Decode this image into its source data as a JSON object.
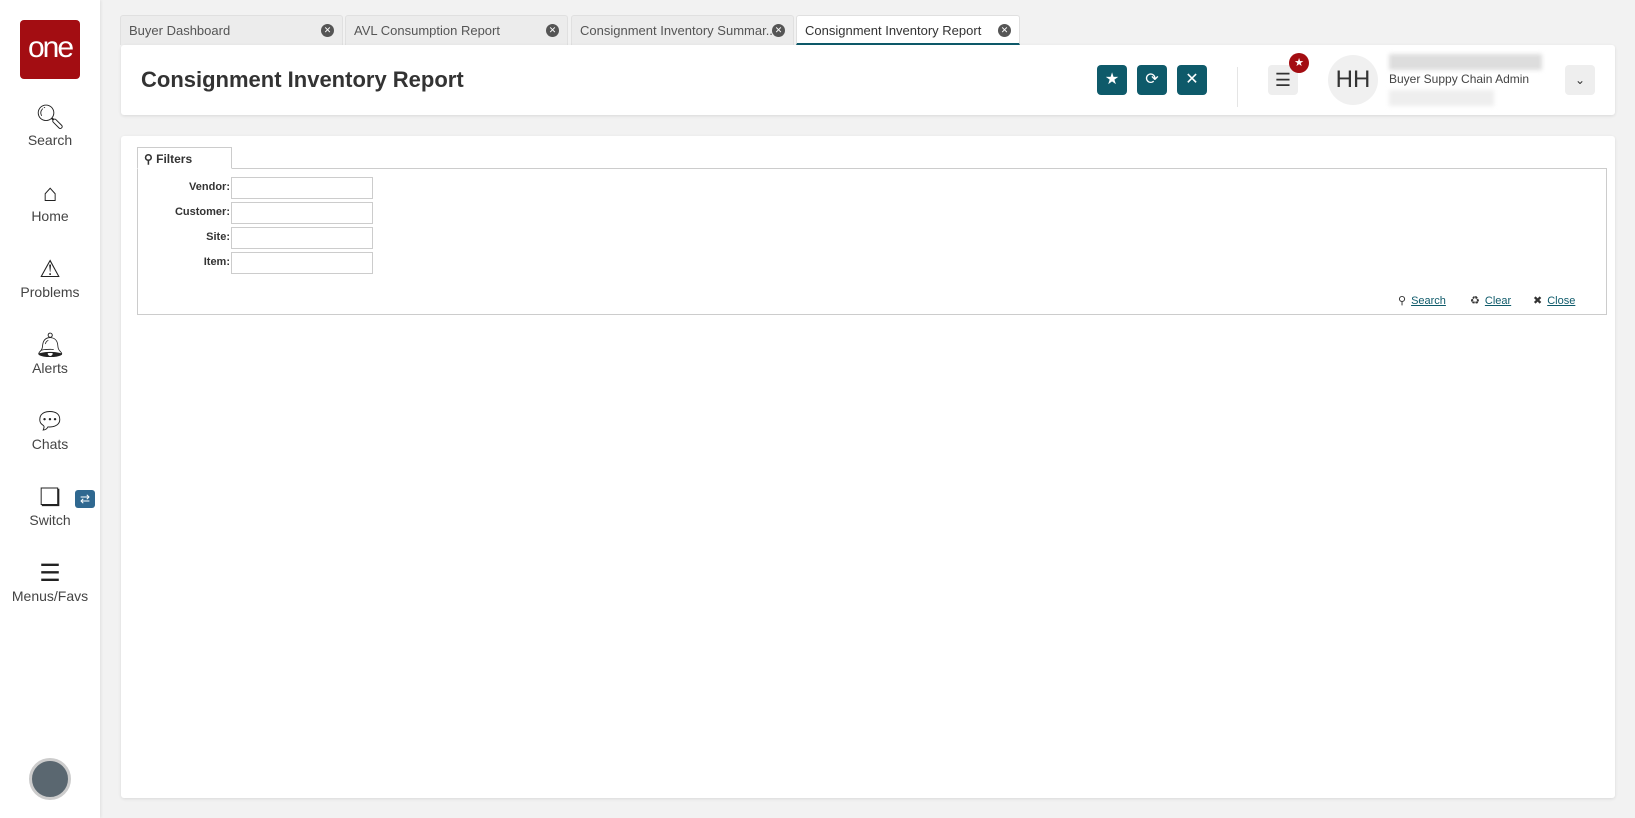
{
  "sidebar": {
    "logo": "one",
    "items": [
      {
        "label": "Search",
        "icon": "search-icon"
      },
      {
        "label": "Home",
        "icon": "home-icon"
      },
      {
        "label": "Problems",
        "icon": "warning-icon"
      },
      {
        "label": "Alerts",
        "icon": "bell-icon"
      },
      {
        "label": "Chats",
        "icon": "chat-icon"
      },
      {
        "label": "Switch",
        "icon": "switch-icon"
      },
      {
        "label": "Menus/Favs",
        "icon": "menu-icon"
      }
    ]
  },
  "tabs": [
    {
      "label": "Buyer Dashboard"
    },
    {
      "label": "AVL Consumption Report"
    },
    {
      "label": "Consignment Inventory Summar..."
    },
    {
      "label": "Consignment Inventory Report",
      "active": true
    }
  ],
  "header": {
    "title": "Consignment Inventory Report",
    "user_initials": "HH",
    "user_role": "Buyer Suppy Chain Admin"
  },
  "filters": {
    "tab_label": "Filters",
    "fields": [
      {
        "label": "Vendor:",
        "value": ""
      },
      {
        "label": "Customer:",
        "value": ""
      },
      {
        "label": "Site:",
        "value": ""
      },
      {
        "label": "Item:",
        "value": ""
      }
    ],
    "search": "Search",
    "clear": "Clear",
    "close": "Close"
  }
}
